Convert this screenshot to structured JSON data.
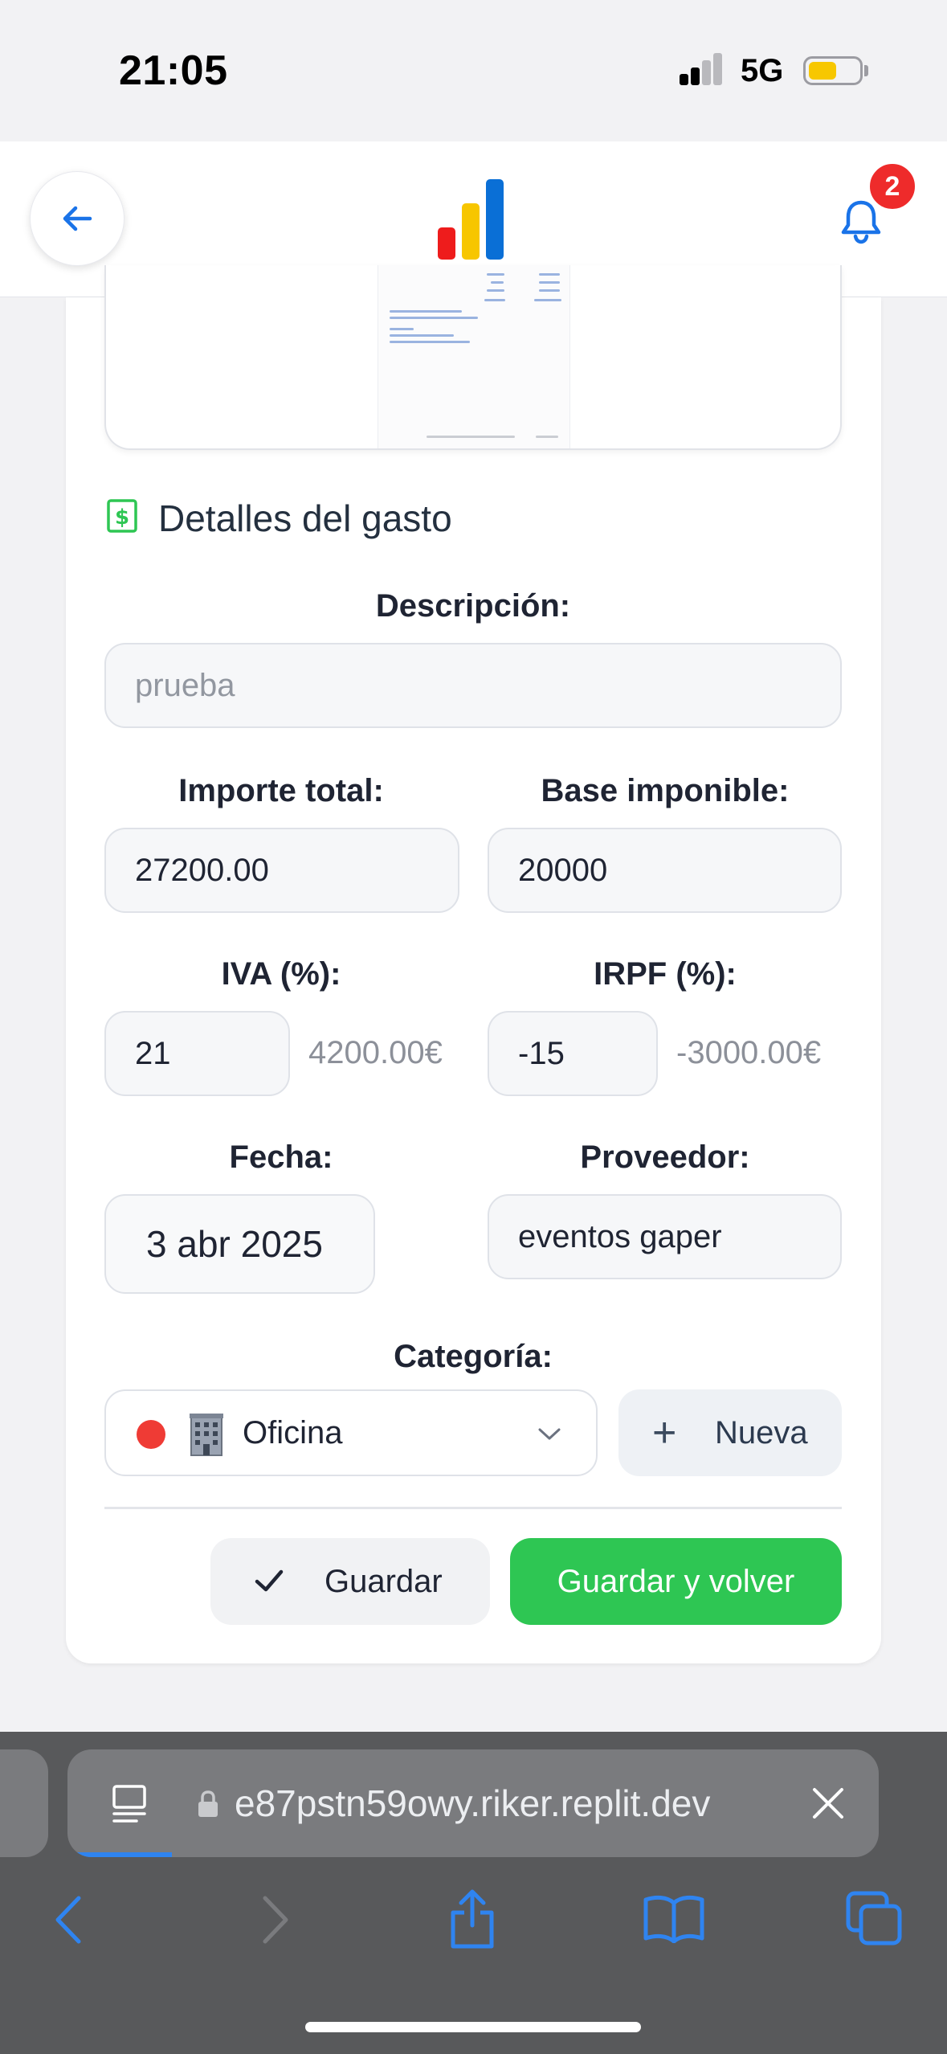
{
  "status_bar": {
    "time": "21:05",
    "network": "5G",
    "battery_level": 0.55,
    "battery_color": "#f7c700"
  },
  "header": {
    "back_icon": "arrow-left-icon",
    "logo_icon": "bar-chart-logo",
    "notification_icon": "bell-icon",
    "notification_count": "2"
  },
  "expense": {
    "section_title": "Detalles del gasto",
    "section_icon": "dollar-receipt-icon",
    "description_label": "Descripción:",
    "description_placeholder": "prueba",
    "total_label": "Importe total:",
    "total_value": "27200.00",
    "base_label": "Base imponible:",
    "base_value": "20000",
    "iva_label": "IVA (%):",
    "iva_value": "21",
    "iva_amount": "4200.00€",
    "irpf_label": "IRPF (%):",
    "irpf_value": "-15",
    "irpf_amount": "-3000.00€",
    "date_label": "Fecha:",
    "date_value": "3 abr 2025",
    "supplier_label": "Proveedor:",
    "supplier_value": "eventos gaper",
    "category_label": "Categoría:",
    "category_value": "Oficina",
    "category_color": "#ef3b35",
    "category_emoji_icon": "office-building-icon",
    "new_category_label": "Nueva",
    "save_label": "Guardar",
    "save_and_back_label": "Guardar y volver"
  },
  "browser": {
    "url": "e87pstn59owy.riker.replit.dev",
    "accent": "#2f84f0"
  }
}
